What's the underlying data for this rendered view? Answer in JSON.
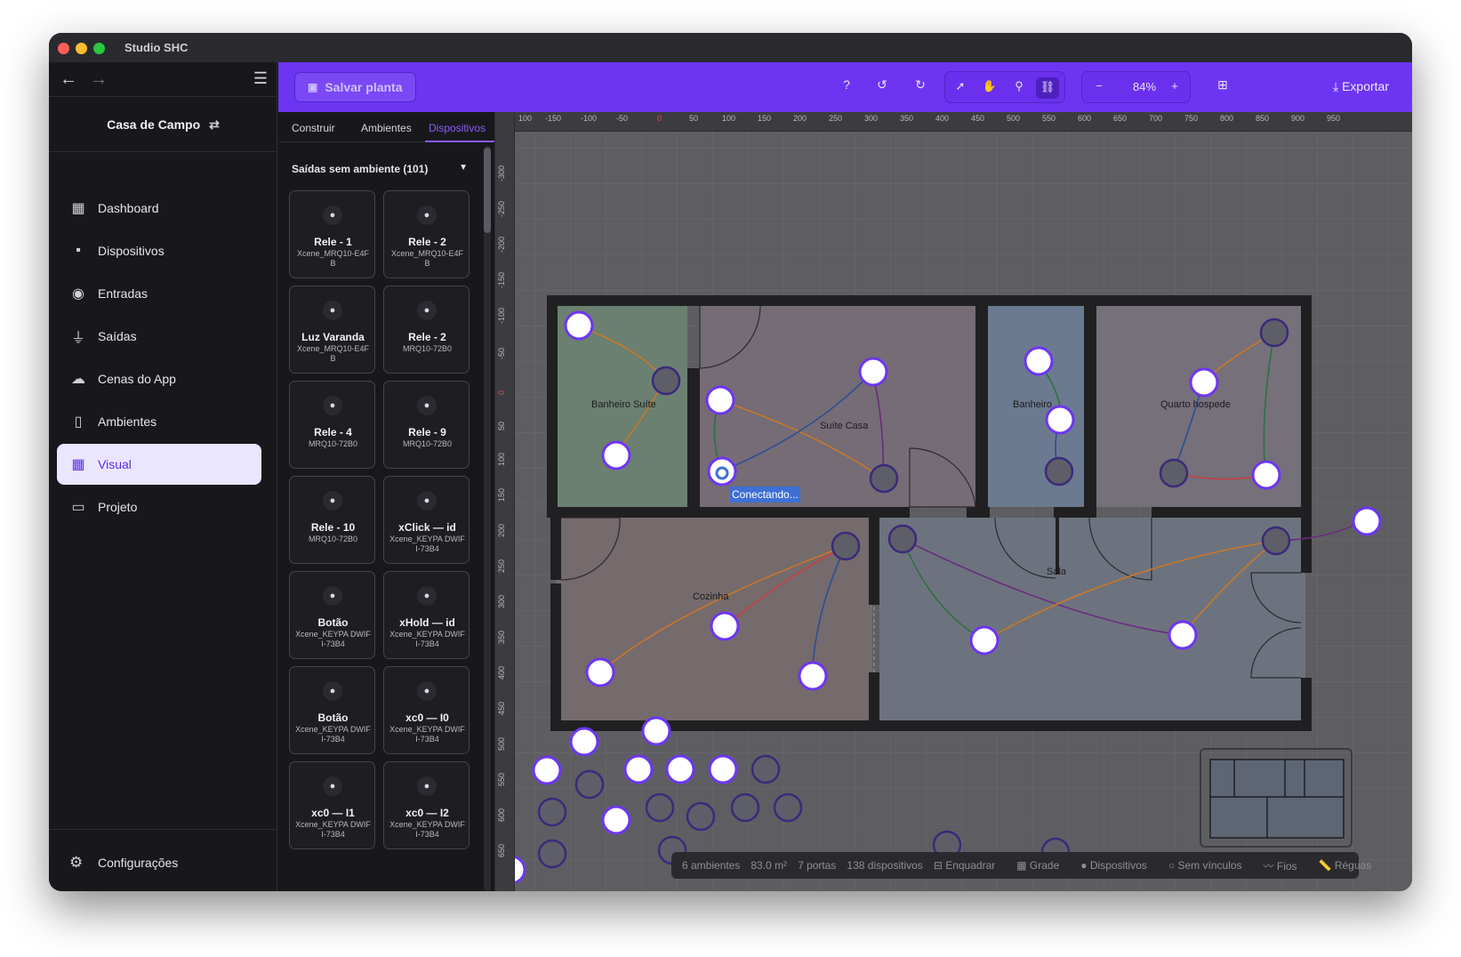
{
  "window": {
    "title": "Studio SHC"
  },
  "sidebar": {
    "house_name": "Casa de Campo",
    "items": [
      {
        "label": "Dashboard",
        "icon": "dashboard-icon"
      },
      {
        "label": "Dispositivos",
        "icon": "devices-icon"
      },
      {
        "label": "Entradas",
        "icon": "signal-icon"
      },
      {
        "label": "Saídas",
        "icon": "plug-icon"
      },
      {
        "label": "Cenas do App",
        "icon": "cloud-icon"
      },
      {
        "label": "Ambientes",
        "icon": "door-icon"
      },
      {
        "label": "Visual",
        "icon": "grid-icon"
      },
      {
        "label": "Projeto",
        "icon": "folder-icon"
      }
    ],
    "active": "Visual",
    "settings_label": "Configurações"
  },
  "toolbar": {
    "save_label": "Salvar planta",
    "help": "?",
    "zoom": "84%",
    "export_label": "Exportar"
  },
  "panel": {
    "tabs": [
      "Construir",
      "Ambientes",
      "Dispositivos"
    ],
    "active_tab": "Dispositivos",
    "group_title": "Saídas sem ambiente (101)",
    "cards": [
      {
        "title": "Rele - 1",
        "sub": "Xcene_MRQ10-E4FB"
      },
      {
        "title": "Rele - 2",
        "sub": "Xcene_MRQ10-E4FB"
      },
      {
        "title": "Luz Varanda",
        "sub": "Xcene_MRQ10-E4FB"
      },
      {
        "title": "Rele - 2",
        "sub": "MRQ10-72B0"
      },
      {
        "title": "Rele - 4",
        "sub": "MRQ10-72B0"
      },
      {
        "title": "Rele - 9",
        "sub": "MRQ10-72B0"
      },
      {
        "title": "Rele - 10",
        "sub": "MRQ10-72B0"
      },
      {
        "title": "xClick — id",
        "sub": "Xcene_KEYPA DWIFI-73B4"
      },
      {
        "title": "Botão",
        "sub": "Xcene_KEYPA DWIFI-73B4"
      },
      {
        "title": "xHold — id",
        "sub": "Xcene_KEYPA DWIFI-73B4"
      },
      {
        "title": "Botão",
        "sub": "Xcene_KEYPA DWIFI-73B4"
      },
      {
        "title": "xc0 — I0",
        "sub": "Xcene_KEYPA DWIFI-73B4"
      },
      {
        "title": "xc0 — I1",
        "sub": "Xcene_KEYPA DWIFI-73B4"
      },
      {
        "title": "xc0 — I2",
        "sub": "Xcene_KEYPA DWIFI-73B4"
      }
    ]
  },
  "canvas": {
    "ruler_top": [
      "100",
      "-150",
      "-100",
      "-50",
      "0",
      "50",
      "100",
      "150",
      "200",
      "250",
      "300",
      "350",
      "400",
      "450",
      "500",
      "550",
      "600",
      "650",
      "700",
      "750",
      "800",
      "850",
      "900",
      "950"
    ],
    "ruler_left": [
      "-300",
      "-250",
      "-200",
      "-150",
      "-100",
      "-50",
      "0",
      "50",
      "100",
      "150",
      "200",
      "250",
      "300",
      "350",
      "400",
      "450",
      "500",
      "550",
      "600",
      "650"
    ],
    "rooms": [
      "Banheiro Suíte",
      "Suíte Casa",
      "Banheiro",
      "Quarto hospede",
      "Cozinha",
      "Sala"
    ],
    "connecting_label": "Conectando...",
    "status": [
      "6 ambientes",
      "83.0 m²",
      "7 portas",
      "138 dispositivos",
      "Enquadrar",
      "Grade",
      "Dispositivos",
      "Sem vínculos",
      "Fios",
      "Réguas"
    ]
  }
}
